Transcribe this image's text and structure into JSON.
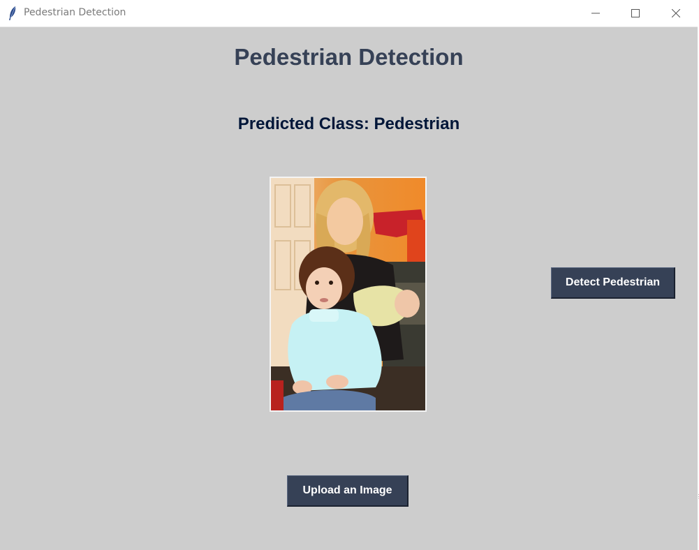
{
  "window": {
    "title": "Pedestrian Detection",
    "icon": "feather-icon",
    "controls": [
      "minimize-icon",
      "maximize-icon",
      "close-icon"
    ]
  },
  "main": {
    "heading": "Pedestrian Detection",
    "prediction_label": "Predicted Class: Pedestrian",
    "image_description": "photo of a woman holding a toddler and a baby"
  },
  "buttons": {
    "detect_label": "Detect Pedestrian",
    "upload_label": "Upload an Image"
  },
  "colors": {
    "background": "#cdcdcd",
    "heading": "#364156",
    "prediction": "#011638",
    "button_bg": "#364156",
    "button_text": "#ffffff"
  }
}
